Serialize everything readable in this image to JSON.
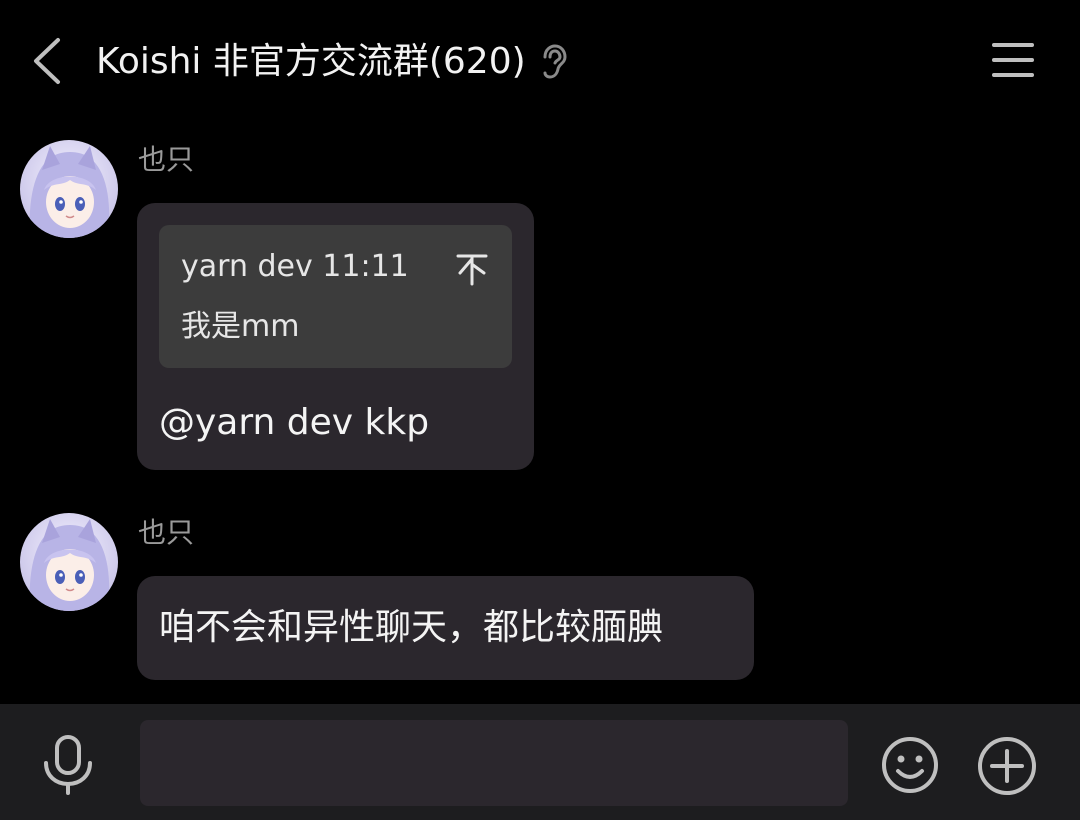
{
  "header": {
    "title": "Koishi 非官方交流群(620)",
    "icons": [
      "back-icon",
      "ear-icon",
      "menu-icon"
    ]
  },
  "messages": [
    {
      "sender": "也只",
      "avatar": "avatar-image",
      "quote": {
        "author_time": "yarn dev 11:11",
        "text": "我是mm",
        "icon": "jump-up-arrow-icon"
      },
      "text": "@yarn dev kkp"
    },
    {
      "sender": "也只",
      "avatar": "avatar-image",
      "text": "咱不会和异性聊天，都比较腼腆"
    }
  ],
  "input_bar": {
    "placeholder": "",
    "icons": [
      "microphone-icon",
      "emoji-icon",
      "plus-icon"
    ]
  },
  "colors": {
    "background": "#000000",
    "bubble": "#2b272d",
    "quote": "#3c3c3c",
    "input_bar": "#1d1d1f",
    "icon": "#bfbfbf"
  }
}
